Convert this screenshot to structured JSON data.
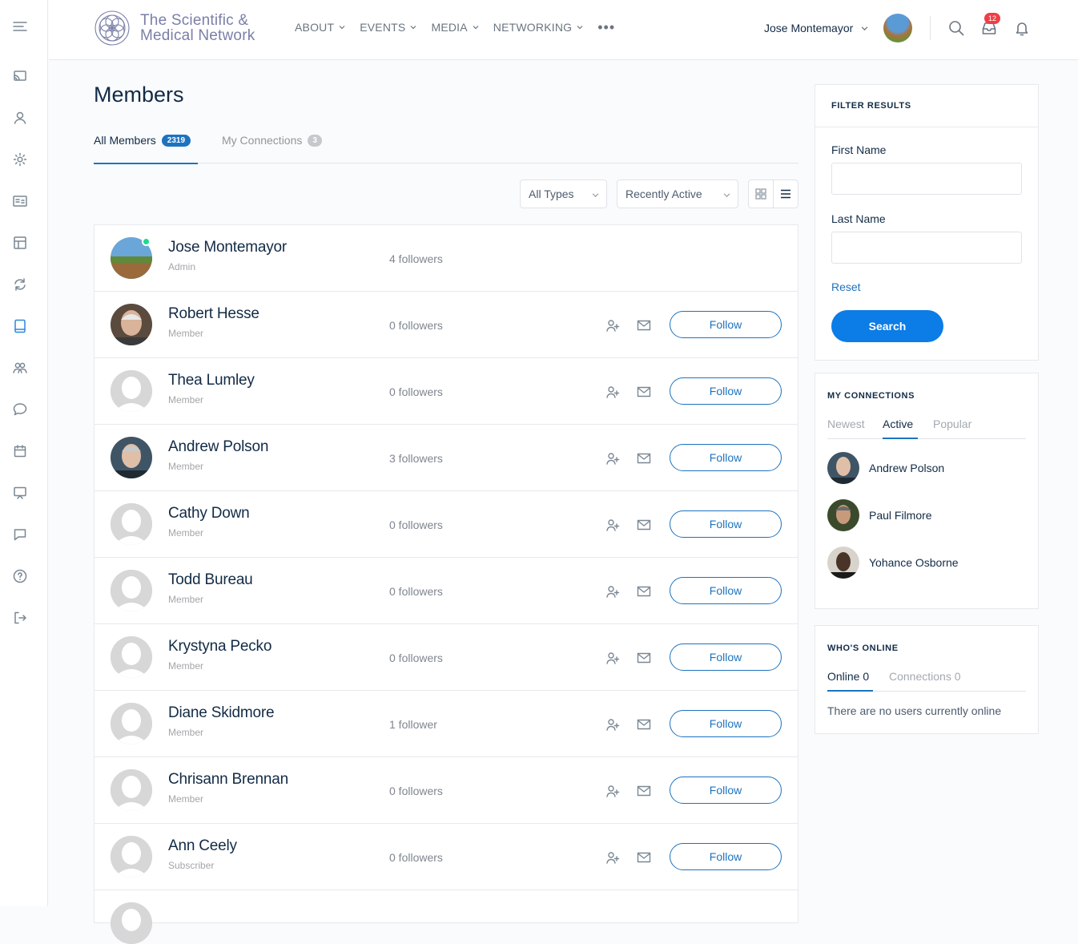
{
  "brand": {
    "line1": "The Scientific &",
    "line2": "Medical Network"
  },
  "nav": {
    "items": [
      "ABOUT",
      "EVENTS",
      "MEDIA",
      "NETWORKING"
    ],
    "more": "•••"
  },
  "user": {
    "name": "Jose Montemayor",
    "inbox_count": "12"
  },
  "page": {
    "title": "Members"
  },
  "tabs": {
    "all_label": "All Members",
    "all_count": "2319",
    "conn_label": "My Connections",
    "conn_count": "3"
  },
  "filters": {
    "type": "All Types",
    "sort": "Recently Active"
  },
  "follow_label": "Follow",
  "members": [
    {
      "name": "Jose Montemayor",
      "role": "Admin",
      "followers": "4 followers"
    },
    {
      "name": "Robert Hesse",
      "role": "Member",
      "followers": "0 followers"
    },
    {
      "name": "Thea Lumley",
      "role": "Member",
      "followers": "0 followers"
    },
    {
      "name": "Andrew Polson",
      "role": "Member",
      "followers": "3 followers"
    },
    {
      "name": "Cathy Down",
      "role": "Member",
      "followers": "0 followers"
    },
    {
      "name": "Todd Bureau",
      "role": "Member",
      "followers": "0 followers"
    },
    {
      "name": "Krystyna Pecko",
      "role": "Member",
      "followers": "0 followers"
    },
    {
      "name": "Diane Skidmore",
      "role": "Member",
      "followers": "1 follower"
    },
    {
      "name": "Chrisann Brennan",
      "role": "Member",
      "followers": "0 followers"
    },
    {
      "name": "Ann Ceely",
      "role": "Subscriber",
      "followers": "0 followers"
    }
  ],
  "filter_widget": {
    "title": "FILTER RESULTS",
    "first_name": "First Name",
    "last_name": "Last Name",
    "reset": "Reset",
    "search": "Search"
  },
  "connections_widget": {
    "title": "MY CONNECTIONS",
    "tabs": [
      "Newest",
      "Active",
      "Popular"
    ],
    "people": [
      "Andrew Polson",
      "Paul Filmore",
      "Yohance Osborne"
    ]
  },
  "online_widget": {
    "title": "WHO'S ONLINE",
    "tab_online": "Online 0",
    "tab_connections": "Connections 0",
    "note": "There are no users currently online"
  },
  "colors": {
    "accent": "#1e73be",
    "button": "#0c7ce6",
    "online": "#1cd991",
    "badge": "#ef3e46"
  }
}
